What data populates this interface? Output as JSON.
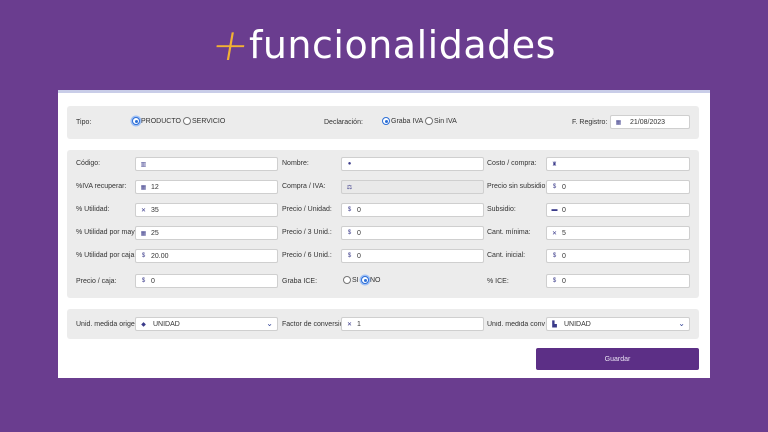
{
  "banner": {
    "plus": "+",
    "title": "funcionalidades"
  },
  "header": {
    "tipo_label": "Tipo:",
    "tipo_options": [
      "PRODUCTO",
      "SERVICIO"
    ],
    "tipo_selected": "PRODUCTO",
    "declaracion_label": "Declaración:",
    "declaracion_options": [
      "Graba IVA",
      "Sin IVA"
    ],
    "declaracion_selected": "Graba IVA",
    "registro_label": "F. Registro:",
    "registro_value": "21/08/2023"
  },
  "fields": {
    "codigo": {
      "label": "Código:",
      "value": ""
    },
    "nombre": {
      "label": "Nombre:",
      "value": ""
    },
    "costo_compra": {
      "label": "Costo / compra:",
      "value": ""
    },
    "iva_recuperar": {
      "label": "%IVA recuperar:",
      "value": "12"
    },
    "compra_iva": {
      "label": "Compra / IVA:",
      "value": ""
    },
    "precio_sin_subsidio": {
      "label": "Precio sin subsidio:",
      "prefix": "$",
      "value": "0"
    },
    "utilidad": {
      "label": "% Utilidad:",
      "value": "35"
    },
    "precio_unidad": {
      "label": "Precio / Unidad:",
      "prefix": "$",
      "value": "0"
    },
    "subsidio": {
      "label": "Subsidio:",
      "value": "0"
    },
    "utilidad_mayor": {
      "label": "% Utilidad por mayor",
      "value": "25"
    },
    "precio_3": {
      "label": "Precio / 3 Unid.:",
      "prefix": "$",
      "value": "0"
    },
    "cant_minima": {
      "label": "Cant. mínima:",
      "value": "5"
    },
    "utilidad_caja": {
      "label": "% Utilidad por caja:",
      "prefix": "$",
      "value": "20.00"
    },
    "precio_6": {
      "label": "Precio / 6 Unid.:",
      "prefix": "$",
      "value": "0"
    },
    "cant_inicial": {
      "label": "Cant. inicial:",
      "prefix": "$",
      "value": "0"
    },
    "precio_caja": {
      "label": "Precio / caja:",
      "prefix": "$",
      "value": "0"
    },
    "graba_ice": {
      "label": "Graba ICE:",
      "options": [
        "SI",
        "NO"
      ],
      "selected": "NO"
    },
    "ice": {
      "label": "% ICE:",
      "prefix": "$",
      "value": "0"
    }
  },
  "units": {
    "origen_label": "Unid. medida origen:",
    "origen_value": "UNIDAD",
    "factor_label": "Factor de conversion",
    "factor_value": "1",
    "convert_label": "Unid. medida converti",
    "convert_value": "UNIDAD"
  },
  "actions": {
    "save_label": "Guardar"
  },
  "colors": {
    "background": "#6a3d8f",
    "accent": "#5c2f86",
    "plus": "#f2b233",
    "radio": "#2d6fd6"
  }
}
